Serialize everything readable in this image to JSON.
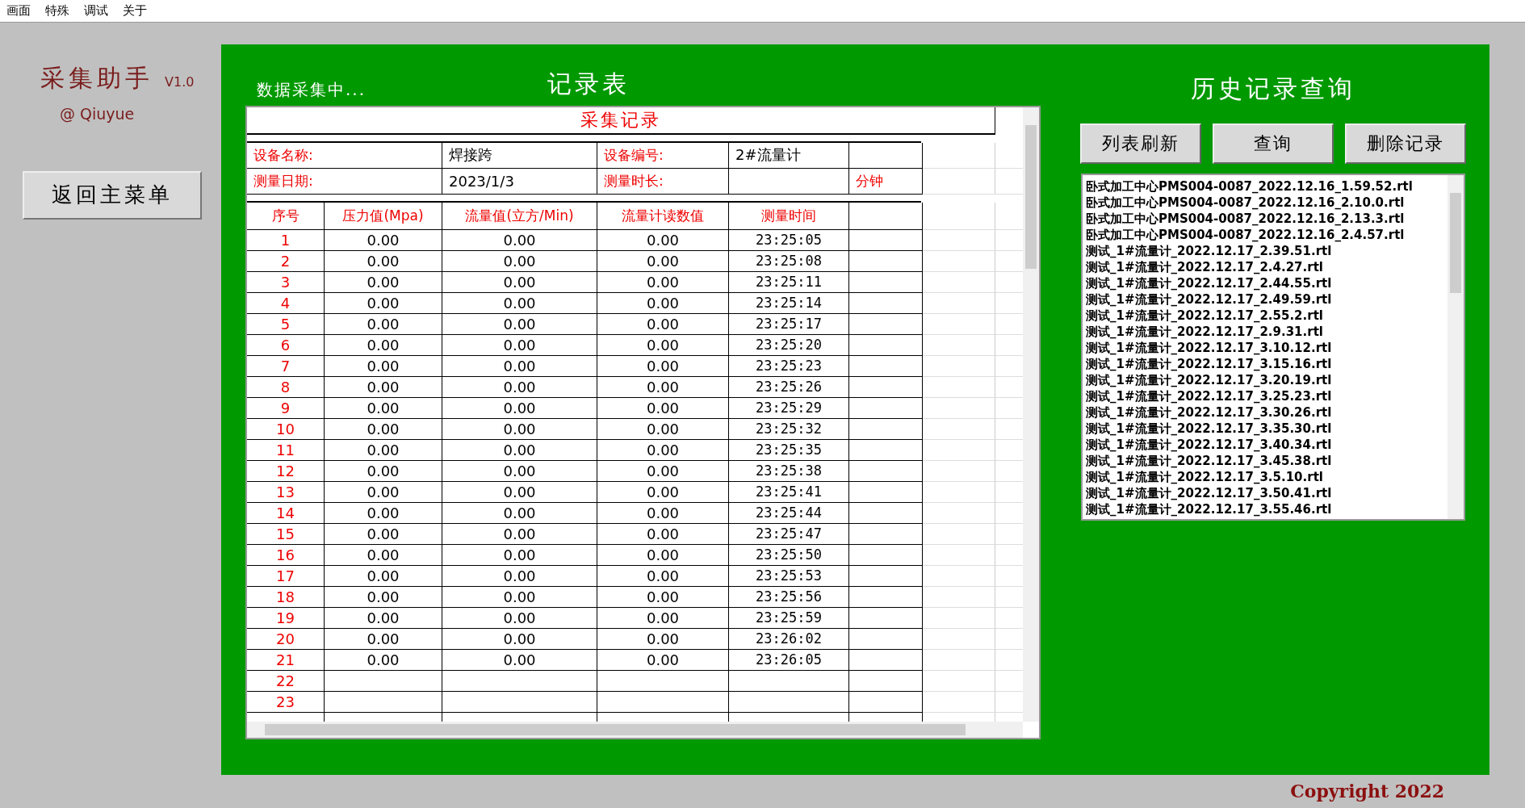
{
  "menu": [
    "画面",
    "特殊",
    "调试",
    "关于"
  ],
  "sidebar": {
    "app_title": "采集助手",
    "version": "V1.0",
    "author": "@ Qiuyue",
    "back_button": "返回主菜单"
  },
  "status": "数据采集中...",
  "record_panel": {
    "title": "记录表",
    "sheet_title": "采集记录",
    "info": [
      {
        "label": "设备名称:",
        "value": "焊接跨",
        "label_2": "设备编号:",
        "value_2": "2#流量计"
      },
      {
        "label": "测量日期:",
        "value": "2023/1/3",
        "label_2": "测量时长:",
        "unit": "分钟"
      }
    ],
    "columns": [
      "序号",
      "压力值(Mpa)",
      "流量值(立方/Min)",
      "流量计读数值",
      "测量时间"
    ],
    "rows": [
      {
        "seq": "1",
        "pressure": "0.00",
        "flow": "0.00",
        "reading": "0.00",
        "time": "23:25:05"
      },
      {
        "seq": "2",
        "pressure": "0.00",
        "flow": "0.00",
        "reading": "0.00",
        "time": "23:25:08"
      },
      {
        "seq": "3",
        "pressure": "0.00",
        "flow": "0.00",
        "reading": "0.00",
        "time": "23:25:11"
      },
      {
        "seq": "4",
        "pressure": "0.00",
        "flow": "0.00",
        "reading": "0.00",
        "time": "23:25:14"
      },
      {
        "seq": "5",
        "pressure": "0.00",
        "flow": "0.00",
        "reading": "0.00",
        "time": "23:25:17"
      },
      {
        "seq": "6",
        "pressure": "0.00",
        "flow": "0.00",
        "reading": "0.00",
        "time": "23:25:20"
      },
      {
        "seq": "7",
        "pressure": "0.00",
        "flow": "0.00",
        "reading": "0.00",
        "time": "23:25:23"
      },
      {
        "seq": "8",
        "pressure": "0.00",
        "flow": "0.00",
        "reading": "0.00",
        "time": "23:25:26"
      },
      {
        "seq": "9",
        "pressure": "0.00",
        "flow": "0.00",
        "reading": "0.00",
        "time": "23:25:29"
      },
      {
        "seq": "10",
        "pressure": "0.00",
        "flow": "0.00",
        "reading": "0.00",
        "time": "23:25:32"
      },
      {
        "seq": "11",
        "pressure": "0.00",
        "flow": "0.00",
        "reading": "0.00",
        "time": "23:25:35"
      },
      {
        "seq": "12",
        "pressure": "0.00",
        "flow": "0.00",
        "reading": "0.00",
        "time": "23:25:38"
      },
      {
        "seq": "13",
        "pressure": "0.00",
        "flow": "0.00",
        "reading": "0.00",
        "time": "23:25:41"
      },
      {
        "seq": "14",
        "pressure": "0.00",
        "flow": "0.00",
        "reading": "0.00",
        "time": "23:25:44"
      },
      {
        "seq": "15",
        "pressure": "0.00",
        "flow": "0.00",
        "reading": "0.00",
        "time": "23:25:47"
      },
      {
        "seq": "16",
        "pressure": "0.00",
        "flow": "0.00",
        "reading": "0.00",
        "time": "23:25:50"
      },
      {
        "seq": "17",
        "pressure": "0.00",
        "flow": "0.00",
        "reading": "0.00",
        "time": "23:25:53"
      },
      {
        "seq": "18",
        "pressure": "0.00",
        "flow": "0.00",
        "reading": "0.00",
        "time": "23:25:56"
      },
      {
        "seq": "19",
        "pressure": "0.00",
        "flow": "0.00",
        "reading": "0.00",
        "time": "23:25:59"
      },
      {
        "seq": "20",
        "pressure": "0.00",
        "flow": "0.00",
        "reading": "0.00",
        "time": "23:26:02"
      },
      {
        "seq": "21",
        "pressure": "0.00",
        "flow": "0.00",
        "reading": "0.00",
        "time": "23:26:05"
      },
      {
        "seq": "22"
      },
      {
        "seq": "23"
      }
    ]
  },
  "history_panel": {
    "title": "历史记录查询",
    "buttons": [
      "列表刷新",
      "查询",
      "删除记录"
    ],
    "files": [
      "卧式加工中心PMS004-0087_2022.12.16_1.59.52.rtl",
      "卧式加工中心PMS004-0087_2022.12.16_2.10.0.rtl",
      "卧式加工中心PMS004-0087_2022.12.16_2.13.3.rtl",
      "卧式加工中心PMS004-0087_2022.12.16_2.4.57.rtl",
      "测试_1#流量计_2022.12.17_2.39.51.rtl",
      "测试_1#流量计_2022.12.17_2.4.27.rtl",
      "测试_1#流量计_2022.12.17_2.44.55.rtl",
      "测试_1#流量计_2022.12.17_2.49.59.rtl",
      "测试_1#流量计_2022.12.17_2.55.2.rtl",
      "测试_1#流量计_2022.12.17_2.9.31.rtl",
      "测试_1#流量计_2022.12.17_3.10.12.rtl",
      "测试_1#流量计_2022.12.17_3.15.16.rtl",
      "测试_1#流量计_2022.12.17_3.20.19.rtl",
      "测试_1#流量计_2022.12.17_3.25.23.rtl",
      "测试_1#流量计_2022.12.17_3.30.26.rtl",
      "测试_1#流量计_2022.12.17_3.35.30.rtl",
      "测试_1#流量计_2022.12.17_3.40.34.rtl",
      "测试_1#流量计_2022.12.17_3.45.38.rtl",
      "测试_1#流量计_2022.12.17_3.5.10.rtl",
      "测试_1#流量计_2022.12.17_3.50.41.rtl",
      "测试_1#流量计_2022.12.17_3.55.46.rtl"
    ]
  },
  "copyright": "Copyright 2022"
}
